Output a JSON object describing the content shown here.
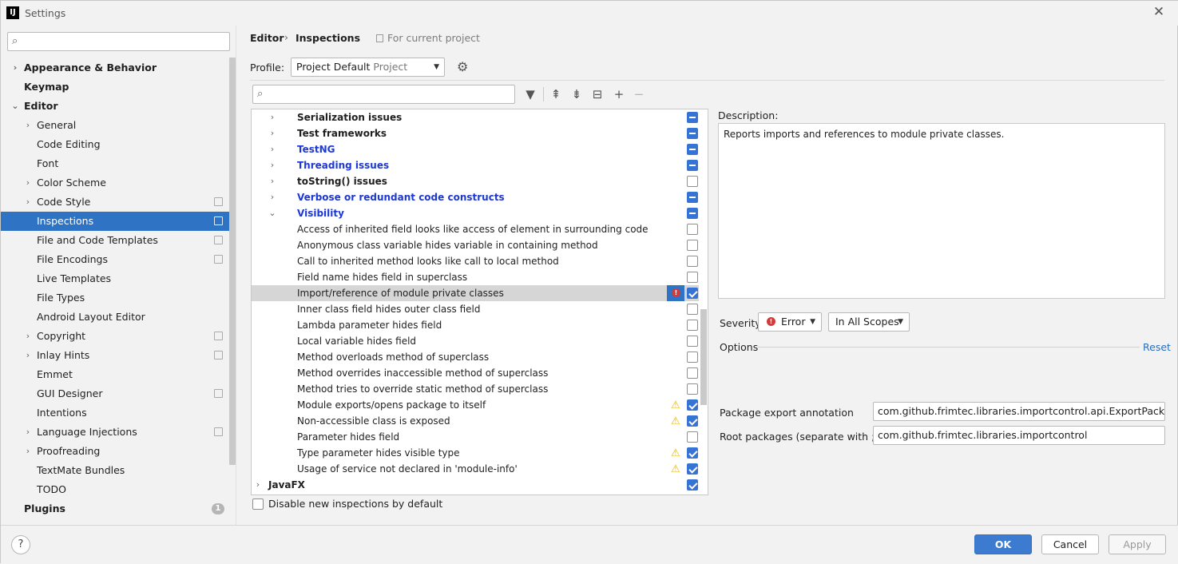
{
  "window": {
    "title": "Settings",
    "logo_text": "IJ",
    "close_glyph": "✕"
  },
  "sidebar": {
    "search_placeholder": "",
    "items": [
      {
        "label": "Appearance & Behavior",
        "level": 0,
        "expandable": true,
        "expanded": false,
        "bold": true
      },
      {
        "label": "Keymap",
        "level": 0,
        "expandable": false,
        "bold": true
      },
      {
        "label": "Editor",
        "level": 0,
        "expandable": true,
        "expanded": true,
        "bold": true
      },
      {
        "label": "General",
        "level": 1,
        "expandable": true,
        "expanded": false
      },
      {
        "label": "Code Editing",
        "level": 1
      },
      {
        "label": "Font",
        "level": 1
      },
      {
        "label": "Color Scheme",
        "level": 1,
        "expandable": true,
        "expanded": false
      },
      {
        "label": "Code Style",
        "level": 1,
        "expandable": true,
        "expanded": false,
        "project_icon": true
      },
      {
        "label": "Inspections",
        "level": 1,
        "selected": true,
        "project_icon": true
      },
      {
        "label": "File and Code Templates",
        "level": 1,
        "project_icon": true
      },
      {
        "label": "File Encodings",
        "level": 1,
        "project_icon": true
      },
      {
        "label": "Live Templates",
        "level": 1
      },
      {
        "label": "File Types",
        "level": 1
      },
      {
        "label": "Android Layout Editor",
        "level": 1
      },
      {
        "label": "Copyright",
        "level": 1,
        "expandable": true,
        "expanded": false,
        "project_icon": true
      },
      {
        "label": "Inlay Hints",
        "level": 1,
        "expandable": true,
        "expanded": false,
        "project_icon": true
      },
      {
        "label": "Emmet",
        "level": 1
      },
      {
        "label": "GUI Designer",
        "level": 1,
        "project_icon": true
      },
      {
        "label": "Intentions",
        "level": 1
      },
      {
        "label": "Language Injections",
        "level": 1,
        "expandable": true,
        "expanded": false,
        "project_icon": true
      },
      {
        "label": "Proofreading",
        "level": 1,
        "expandable": true,
        "expanded": false
      },
      {
        "label": "TextMate Bundles",
        "level": 1
      },
      {
        "label": "TODO",
        "level": 1
      },
      {
        "label": "Plugins",
        "level": 0,
        "bold": true,
        "badge": "1"
      }
    ]
  },
  "breadcrumb": {
    "part1": "Editor",
    "separator": "›",
    "part2": "Inspections",
    "scope_note": "For current project"
  },
  "profile": {
    "label": "Profile:",
    "value": "Project Default",
    "sub": "Project"
  },
  "toolbar": {
    "search_placeholder": "",
    "icons": [
      "filter-icon",
      "expand-all-icon",
      "collapse-all-icon",
      "reset-icon",
      "add-icon",
      "remove-icon"
    ]
  },
  "inspections": [
    {
      "label": "Serialization issues",
      "type": "group",
      "expanded": false,
      "state": "partial"
    },
    {
      "label": "Test frameworks",
      "type": "group",
      "expanded": false,
      "state": "partial"
    },
    {
      "label": "TestNG",
      "type": "group",
      "blue": true,
      "expanded": false,
      "state": "partial"
    },
    {
      "label": "Threading issues",
      "type": "group",
      "blue": true,
      "expanded": false,
      "state": "partial"
    },
    {
      "label": "toString() issues",
      "type": "group",
      "expanded": false,
      "state": "unchecked"
    },
    {
      "label": "Verbose or redundant code constructs",
      "type": "group",
      "blue": true,
      "expanded": false,
      "state": "partial"
    },
    {
      "label": "Visibility",
      "type": "group",
      "blue": true,
      "expanded": true,
      "state": "partial"
    },
    {
      "label": "Access of inherited field looks like access of element in surrounding code",
      "type": "item",
      "state": "unchecked"
    },
    {
      "label": "Anonymous class variable hides variable in containing method",
      "type": "item",
      "state": "unchecked"
    },
    {
      "label": "Call to inherited method looks like call to local method",
      "type": "item",
      "state": "unchecked"
    },
    {
      "label": "Field name hides field in superclass",
      "type": "item",
      "state": "unchecked"
    },
    {
      "label": "Import/reference of module private classes",
      "type": "item",
      "state": "checked",
      "severity": "error",
      "selected": true
    },
    {
      "label": "Inner class field hides outer class field",
      "type": "item",
      "state": "unchecked"
    },
    {
      "label": "Lambda parameter hides field",
      "type": "item",
      "state": "unchecked"
    },
    {
      "label": "Local variable hides field",
      "type": "item",
      "state": "unchecked"
    },
    {
      "label": "Method overloads method of superclass",
      "type": "item",
      "state": "unchecked"
    },
    {
      "label": "Method overrides inaccessible method of superclass",
      "type": "item",
      "state": "unchecked"
    },
    {
      "label": "Method tries to override static method of superclass",
      "type": "item",
      "state": "unchecked"
    },
    {
      "label": "Module exports/opens package to itself",
      "type": "item",
      "state": "checked",
      "severity": "warning"
    },
    {
      "label": "Non-accessible class is exposed",
      "type": "item",
      "state": "checked",
      "severity": "warning"
    },
    {
      "label": "Parameter hides field",
      "type": "item",
      "state": "unchecked"
    },
    {
      "label": "Type parameter hides visible type",
      "type": "item",
      "state": "checked",
      "severity": "warning"
    },
    {
      "label": "Usage of service not declared in 'module-info'",
      "type": "item",
      "state": "checked",
      "severity": "warning"
    },
    {
      "label": "JavaFX",
      "type": "root",
      "expanded": false,
      "state": "checked"
    }
  ],
  "disable_new": {
    "label": "Disable new inspections by default",
    "checked": false
  },
  "description": {
    "label": "Description:",
    "text": "Reports imports and references to module private classes."
  },
  "severity": {
    "label": "Severity:",
    "value": "Error",
    "scope": "In All Scopes"
  },
  "options": {
    "label": "Options",
    "reset": "Reset",
    "fields": [
      {
        "label": "Package export annotation",
        "value": "com.github.frimtec.libraries.importcontrol.api.ExportPackage"
      },
      {
        "label": "Root packages (separate with ;)",
        "value": "com.github.frimtec.libraries.importcontrol"
      }
    ]
  },
  "footer": {
    "help": "?",
    "ok": "OK",
    "cancel": "Cancel",
    "apply": "Apply"
  },
  "colors": {
    "selection": "#2f73c4",
    "checkbox": "#3574d4",
    "error": "#d13b3b",
    "warning": "#e8b800",
    "link": "#2a6ebb",
    "group_blue": "#1d38d6"
  }
}
